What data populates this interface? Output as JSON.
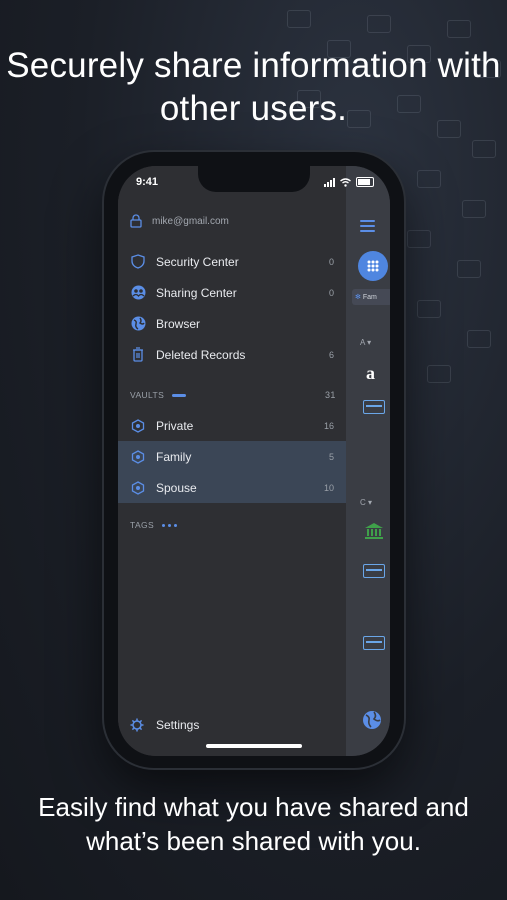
{
  "headline": "Securely share information with other users.",
  "footer": "Easily find what you have shared and what’s been shared with you.",
  "status": {
    "time": "9:41"
  },
  "account": {
    "email": "mike@gmail.com"
  },
  "menu": [
    {
      "label": "Security Center",
      "count": "0",
      "icon": "shield-icon"
    },
    {
      "label": "Sharing Center",
      "count": "0",
      "icon": "users-icon"
    },
    {
      "label": "Browser",
      "count": "",
      "icon": "globe-icon"
    },
    {
      "label": "Deleted Records",
      "count": "6",
      "icon": "trash-icon"
    }
  ],
  "vaults": {
    "title": "VAULTS",
    "count": "31",
    "items": [
      {
        "label": "Private",
        "count": "16",
        "selected": false
      },
      {
        "label": "Family",
        "count": "5",
        "selected": true
      },
      {
        "label": "Spouse",
        "count": "10",
        "selected": true
      }
    ]
  },
  "tags": {
    "title": "TAGS"
  },
  "settings": {
    "label": "Settings",
    "icon": "gear-icon"
  },
  "side": {
    "chip_label": "Fam",
    "letter_a": "A",
    "letter_c": "C",
    "amazon_logo": "a"
  },
  "colors": {
    "accent": "#5b8ee6",
    "selected_row": "#3b4656",
    "drawer_bg": "#2e2f33"
  }
}
